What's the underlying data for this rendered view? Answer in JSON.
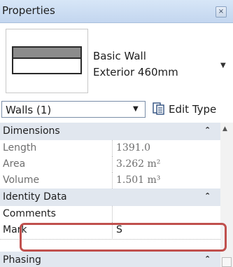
{
  "titlebar": {
    "title": "Properties",
    "close_glyph": "×"
  },
  "type_selector": {
    "family": "Basic Wall",
    "type_name": "Exterior 460mm",
    "dropdown_glyph": "▼"
  },
  "filter": {
    "label": "Walls (1)",
    "dropdown_glyph": "▼",
    "edit_type_label": "Edit Type"
  },
  "groups": {
    "dimensions": {
      "label": "Dimensions",
      "toggle": "⌃"
    },
    "identity": {
      "label": "Identity Data",
      "toggle": "⌃"
    },
    "phasing": {
      "label": "Phasing",
      "toggle": "⌃"
    }
  },
  "properties": {
    "length": {
      "name": "Length",
      "value": "1391.0"
    },
    "area": {
      "name": "Area",
      "value": "3.262 m²"
    },
    "volume": {
      "name": "Volume",
      "value": "1.501 m³"
    },
    "comments": {
      "name": "Comments",
      "value": ""
    },
    "mark": {
      "name": "Mark",
      "value": "S"
    }
  },
  "scrollbar": {
    "up_glyph": "▲"
  },
  "colors": {
    "titlebar": "#c9dbf0",
    "group_header": "#e1e7ef",
    "highlight": "#c0504d"
  }
}
